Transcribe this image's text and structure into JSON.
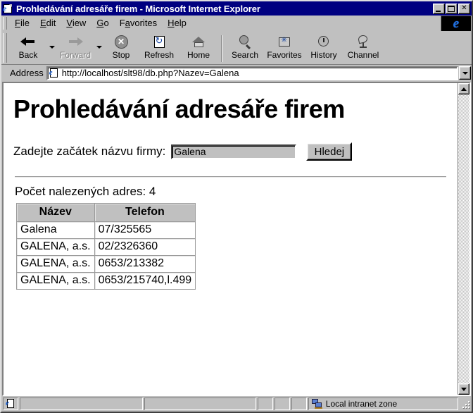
{
  "window": {
    "title": "Prohledávání adresáře firem - Microsoft Internet Explorer",
    "title_icon": "ie-document-icon",
    "minimize_label": "_",
    "maximize_label": "□",
    "close_label": "✕"
  },
  "menu": {
    "items": [
      {
        "label": "File",
        "accel": "F",
        "rest": "ile"
      },
      {
        "label": "Edit",
        "accel": "E",
        "rest": "dit"
      },
      {
        "label": "View",
        "accel": "V",
        "rest": "iew"
      },
      {
        "label": "Go",
        "accel": "G",
        "rest": "o"
      },
      {
        "label": "Favorites",
        "pre": "F",
        "accel": "a",
        "rest": "vorites"
      },
      {
        "label": "Help",
        "accel": "H",
        "rest": "elp"
      }
    ],
    "logo": "e"
  },
  "toolbar": {
    "buttons": [
      {
        "label": "Back",
        "icon": "arrow-left-icon",
        "enabled": true,
        "dropdown": true
      },
      {
        "label": "Forward",
        "icon": "arrow-right-icon",
        "enabled": false,
        "dropdown": true
      },
      {
        "label": "Stop",
        "icon": "stop-icon",
        "enabled": true,
        "dropdown": false
      },
      {
        "label": "Refresh",
        "icon": "refresh-icon",
        "enabled": true,
        "dropdown": false
      },
      {
        "label": "Home",
        "icon": "home-icon",
        "enabled": true,
        "dropdown": false
      },
      {
        "label": "Search",
        "icon": "search-globe-icon",
        "enabled": true,
        "dropdown": false
      },
      {
        "label": "Favorites",
        "icon": "favorites-folder-icon",
        "enabled": true,
        "dropdown": false
      },
      {
        "label": "History",
        "icon": "history-clock-icon",
        "enabled": true,
        "dropdown": false
      },
      {
        "label": "Channel",
        "icon": "channels-dish-icon",
        "enabled": true,
        "dropdown": false
      }
    ],
    "stop_glyph": "✕"
  },
  "address": {
    "label": "Address",
    "url": "http://localhost/slt98/db.php?Nazev=Galena",
    "icon": "ie-document-icon",
    "dropdown_icon": "chevron-down-icon"
  },
  "page": {
    "heading": "Prohledávání adresáře firem",
    "form": {
      "label": "Zadejte začátek názvu firmy:",
      "input_value": "Galena",
      "input_placeholder": "",
      "submit_label": "Hledej"
    },
    "result_count_text": "Počet nalezených adres: 4",
    "table": {
      "headers": [
        "Název",
        "Telefon"
      ],
      "rows": [
        [
          "Galena",
          "07/325565"
        ],
        [
          "GALENA, a.s.",
          "02/2326360"
        ],
        [
          "GALENA, a.s.",
          "0653/213382"
        ],
        [
          "GALENA, a.s.",
          "0653/215740,l.499"
        ]
      ]
    }
  },
  "statusbar": {
    "icon": "ie-document-icon",
    "zone_icon": "network-computers-icon",
    "zone_text": "Local intranet zone",
    "panel1_text": "",
    "panel2_text": ""
  },
  "scrollbar": {
    "up_icon": "triangle-up-icon",
    "down_icon": "triangle-down-icon"
  },
  "colors": {
    "titlebar": "#000080",
    "chrome": "#c0c0c0",
    "page_bg": "#ffffff",
    "table_header_bg": "#c0c0c0"
  }
}
